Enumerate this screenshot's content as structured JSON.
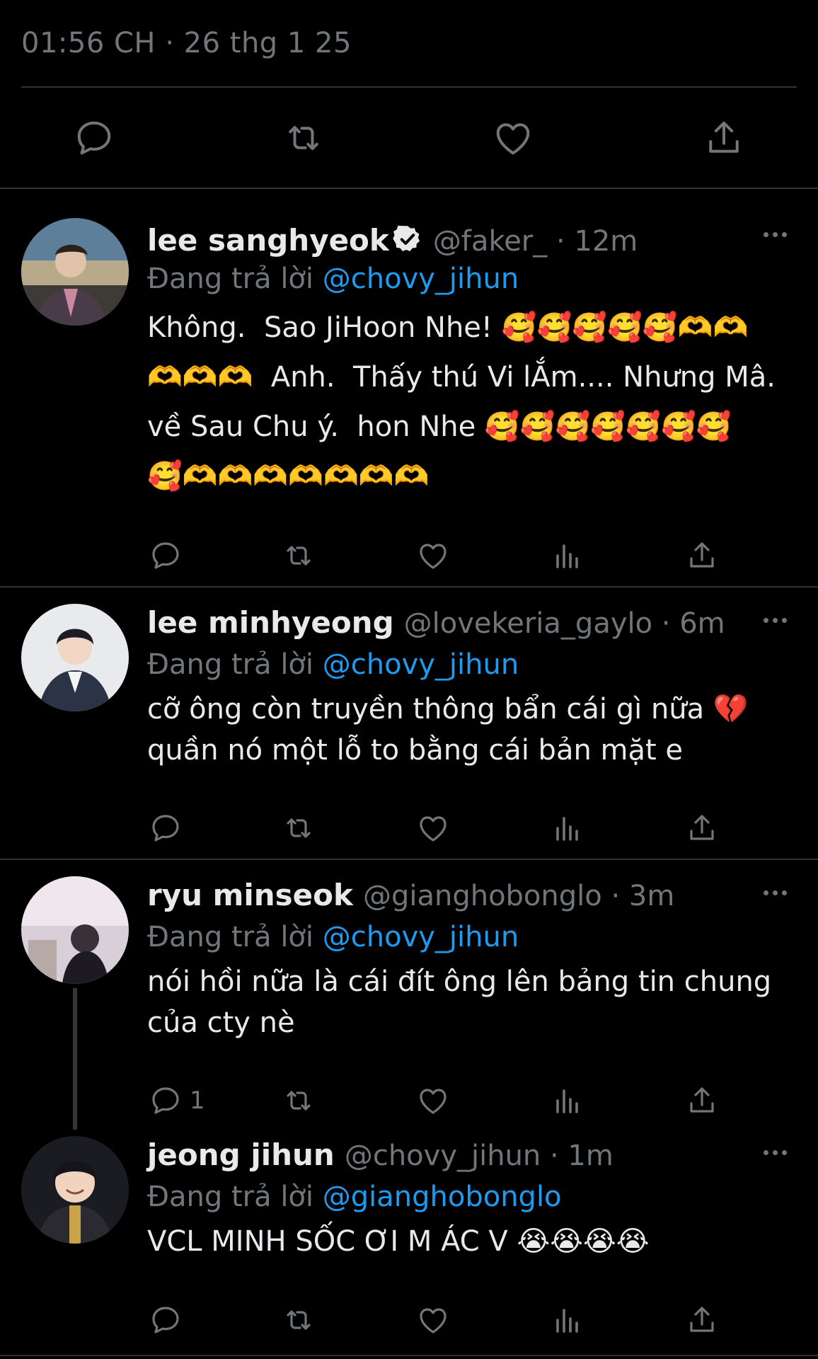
{
  "header": {
    "timestamp": "01:56 CH · 26 thg 1 25"
  },
  "icons": {
    "reply": "reply-icon",
    "retweet": "retweet-icon",
    "like": "heart-icon",
    "views": "bar-chart-icon",
    "share": "share-icon",
    "more": "more-icon",
    "verified": "verified-badge-icon"
  },
  "colors": {
    "background": "#000000",
    "text": "#e7e9ea",
    "muted": "#71767b",
    "link": "#1d9bf0",
    "divider": "#2f3336"
  },
  "tweets": [
    {
      "name": "lee sanghyeok",
      "verified": true,
      "handle": "@faker_ · 12m",
      "reply_label": "Đang trả lời",
      "reply_mention": "@chovy_jihun",
      "text": "Không.  Sao JiHoon Nhe! 🥰🥰🥰🥰🥰🫶🫶\n🫶🫶🫶  Anh.  Thấy thú Vi lẮm.... Nhưng Mâ.\nvề Sau Chu ý.  hon Nhe 🥰🥰🥰🥰🥰🥰🥰\n🥰🫶🫶🫶🫶🫶🫶🫶",
      "reply_count": ""
    },
    {
      "name": "lee minhyeong",
      "verified": false,
      "handle": "@lovekeria_gaylo · 6m",
      "reply_label": "Đang trả lời",
      "reply_mention": "@chovy_jihun",
      "text": "cỡ ông còn truyền thông bẩn cái gì nữa 💔\nquần nó một lỗ to bằng cái bản mặt e",
      "reply_count": ""
    },
    {
      "name": "ryu minseok",
      "verified": false,
      "handle": "@gianghobonglo · 3m",
      "reply_label": "Đang trả lời",
      "reply_mention": "@chovy_jihun",
      "text": "nói hồi nữa là cái đít ông lên bảng tin chung\ncủa cty nè",
      "reply_count": "1"
    },
    {
      "name": "jeong jihun",
      "verified": false,
      "handle": "@chovy_jihun · 1m",
      "reply_label": "Đang trả lời",
      "reply_mention": "@gianghobonglo",
      "text": "VCL MINH SỐC ƠI M ÁC V 😭😭😭😭",
      "reply_count": ""
    }
  ]
}
